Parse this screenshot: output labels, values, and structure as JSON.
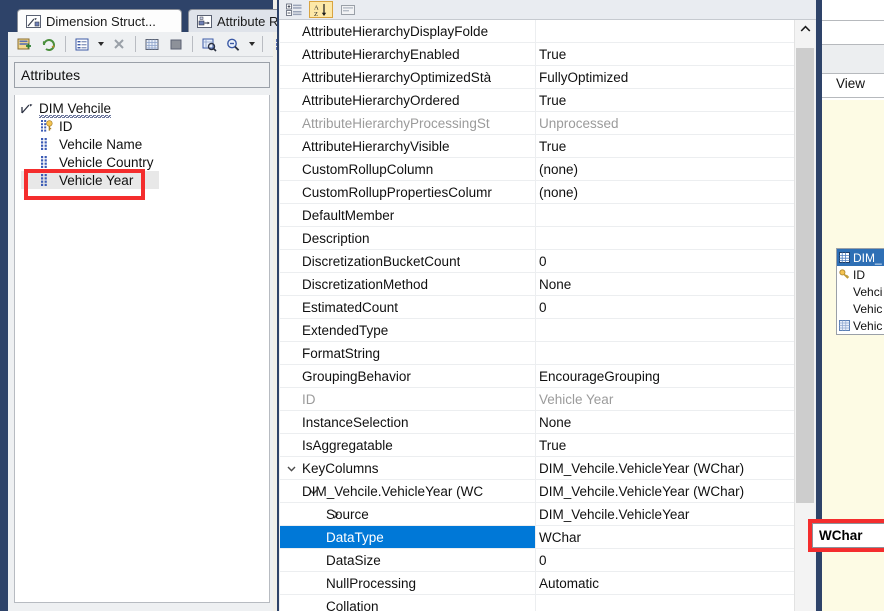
{
  "left_pane": {
    "tabs": [
      {
        "label": "Dimension Struct...",
        "icon": "dimension-structure-icon",
        "active": true
      },
      {
        "label": "Attribute Re",
        "icon": "attribute-relationships-icon",
        "active": false
      }
    ],
    "toolbar": [
      {
        "name": "new-attribute-icon",
        "label": ""
      },
      {
        "name": "refresh-icon",
        "label": ""
      },
      {
        "name": "properties-list-icon",
        "label": ""
      },
      {
        "name": "dropdown-arrow-icon",
        "label": ""
      },
      {
        "name": "delete-icon",
        "label": ""
      },
      {
        "name": "show-grid-icon",
        "label": ""
      },
      {
        "name": "fill-color-icon",
        "label": ""
      },
      {
        "name": "zoom-region-icon",
        "label": ""
      },
      {
        "name": "zoom-out-icon",
        "label": ""
      },
      {
        "name": "dropdown-arrow-icon-2",
        "label": ""
      }
    ],
    "section_title": "Attributes",
    "tree": {
      "root": {
        "label": "DIM Vehcile",
        "icon": "dimension-icon"
      },
      "children": [
        {
          "label": "ID",
          "icon": "key-attribute-icon"
        },
        {
          "label": "Vehcile Name",
          "icon": "attribute-icon"
        },
        {
          "label": "Vehicle Country",
          "icon": "attribute-icon"
        },
        {
          "label": "Vehicle Year",
          "icon": "attribute-icon",
          "highlighted": true
        }
      ]
    }
  },
  "properties": {
    "toolbar": [
      {
        "name": "categorized-button",
        "active": false
      },
      {
        "name": "alphabetical-sort-button",
        "active": true
      },
      {
        "name": "property-pages-button",
        "active": false
      }
    ],
    "rows": [
      {
        "name": "AttributeHierarchyDisplayFolde",
        "value": "",
        "indent": 0,
        "chevron": "",
        "dim": false,
        "selected": false
      },
      {
        "name": "AttributeHierarchyEnabled",
        "value": "True",
        "indent": 0,
        "chevron": "",
        "dim": false,
        "selected": false
      },
      {
        "name": "AttributeHierarchyOptimizedStà",
        "value": "FullyOptimized",
        "indent": 0,
        "chevron": "",
        "dim": false,
        "selected": false
      },
      {
        "name": "AttributeHierarchyOrdered",
        "value": "True",
        "indent": 0,
        "chevron": "",
        "dim": false,
        "selected": false
      },
      {
        "name": "AttributeHierarchyProcessingSt",
        "value": "Unprocessed",
        "indent": 0,
        "chevron": "",
        "dim": true,
        "selected": false
      },
      {
        "name": "AttributeHierarchyVisible",
        "value": "True",
        "indent": 0,
        "chevron": "",
        "dim": false,
        "selected": false
      },
      {
        "name": "CustomRollupColumn",
        "value": "(none)",
        "indent": 0,
        "chevron": "",
        "dim": false,
        "selected": false
      },
      {
        "name": "CustomRollupPropertiesColumr",
        "value": "(none)",
        "indent": 0,
        "chevron": "",
        "dim": false,
        "selected": false
      },
      {
        "name": "DefaultMember",
        "value": "",
        "indent": 0,
        "chevron": "",
        "dim": false,
        "selected": false
      },
      {
        "name": "Description",
        "value": "",
        "indent": 0,
        "chevron": "",
        "dim": false,
        "selected": false
      },
      {
        "name": "DiscretizationBucketCount",
        "value": "0",
        "indent": 0,
        "chevron": "",
        "dim": false,
        "selected": false
      },
      {
        "name": "DiscretizationMethod",
        "value": "None",
        "indent": 0,
        "chevron": "",
        "dim": false,
        "selected": false
      },
      {
        "name": "EstimatedCount",
        "value": "0",
        "indent": 0,
        "chevron": "",
        "dim": false,
        "selected": false
      },
      {
        "name": "ExtendedType",
        "value": "",
        "indent": 0,
        "chevron": "",
        "dim": false,
        "selected": false
      },
      {
        "name": "FormatString",
        "value": "",
        "indent": 0,
        "chevron": "",
        "dim": false,
        "selected": false
      },
      {
        "name": "GroupingBehavior",
        "value": "EncourageGrouping",
        "indent": 0,
        "chevron": "",
        "dim": false,
        "selected": false
      },
      {
        "name": "ID",
        "value": "Vehicle Year",
        "indent": 0,
        "chevron": "",
        "dim": true,
        "selected": false
      },
      {
        "name": "InstanceSelection",
        "value": "None",
        "indent": 0,
        "chevron": "",
        "dim": false,
        "selected": false
      },
      {
        "name": "IsAggregatable",
        "value": "True",
        "indent": 0,
        "chevron": "",
        "dim": false,
        "selected": false
      },
      {
        "name": "KeyColumns",
        "value": "DIM_Vehcile.VehicleYear (WChar)",
        "indent": 0,
        "chevron": "expanded",
        "dim": false,
        "selected": false
      },
      {
        "name": "DIM_Vehcile.VehicleYear (WC",
        "value": "DIM_Vehcile.VehicleYear (WChar)",
        "indent": 1,
        "chevron": "expanded",
        "dim": false,
        "selected": false
      },
      {
        "name": "Source",
        "value": "DIM_Vehcile.VehicleYear",
        "indent": 2,
        "chevron": "collapsed",
        "dim": false,
        "selected": false
      },
      {
        "name": "DataType",
        "value": "WChar",
        "indent": 2,
        "chevron": "",
        "dim": false,
        "selected": true
      },
      {
        "name": "DataSize",
        "value": "0",
        "indent": 2,
        "chevron": "",
        "dim": false,
        "selected": false
      },
      {
        "name": "NullProcessing",
        "value": "Automatic",
        "indent": 2,
        "chevron": "",
        "dim": false,
        "selected": false
      },
      {
        "name": "Collation",
        "value": "",
        "indent": 2,
        "chevron": "",
        "dim": false,
        "selected": false
      }
    ],
    "editor": {
      "value": "WChar",
      "dropdown_icon": "chevron-down-icon"
    },
    "scroll_up_icon": "chevron-up-icon"
  },
  "right_pane": {
    "view_label": "View",
    "table": {
      "title": "DIM_",
      "title_icon": "table-icon",
      "rows": [
        {
          "label": "ID",
          "icon": "key-icon"
        },
        {
          "label": "Vehci",
          "icon": ""
        },
        {
          "label": "Vehic",
          "icon": ""
        },
        {
          "label": "Vehic",
          "icon": "calculated-column-icon"
        }
      ]
    }
  },
  "colors": {
    "chrome": "#2e4369",
    "selection": "#0078d7",
    "annotation": "#f42d2d",
    "canvas": "#fdfbe4",
    "table_header": "#2e6fb5"
  }
}
